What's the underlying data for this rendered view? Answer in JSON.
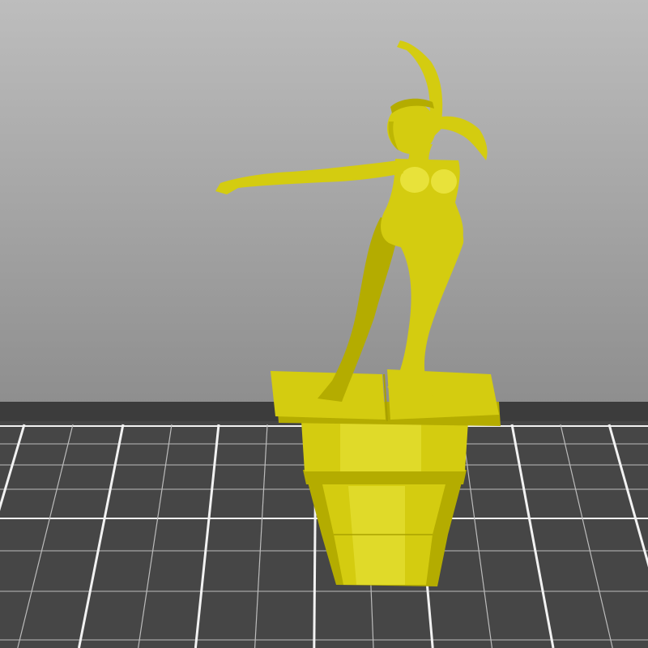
{
  "viewer": {
    "model_color": "#d4cc10",
    "model_shade": "#b4ac00",
    "model_highlight": "#e8e23a",
    "background_top": "#bdbdbd",
    "background_bottom": "#8e8e8e",
    "bed_color": "#464646",
    "bed_gridline_color": "#bcbcbc",
    "bed_major_gridline_color": "#f2f2f2",
    "grid_visible": true
  },
  "model": {
    "icon": "figurine-on-pedestal"
  }
}
